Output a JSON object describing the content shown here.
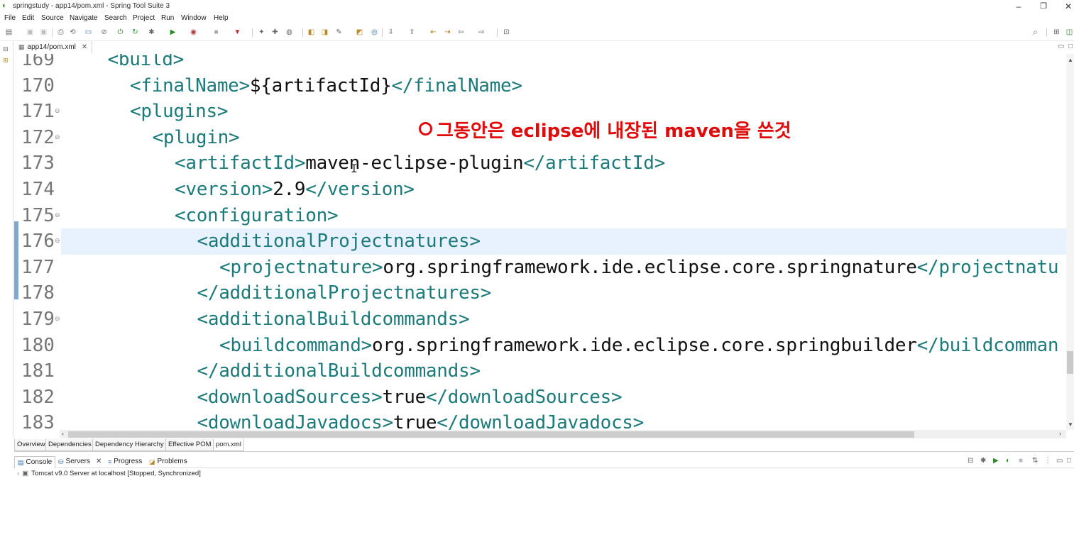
{
  "window": {
    "title": "springstudy - app14/pom.xml - Spring Tool Suite 3",
    "minimize": "–",
    "restore": "❐",
    "close": "✕"
  },
  "menu": [
    "File",
    "Edit",
    "Source",
    "Navigate",
    "Search",
    "Project",
    "Run",
    "Window",
    "Help"
  ],
  "editor_tab": {
    "label": "app14/pom.xml",
    "close": "✕"
  },
  "editor_lines": [
    {
      "num": "169",
      "indent": 1,
      "parts": [
        {
          "t": "tag",
          "s": "<build>"
        }
      ],
      "fold": false,
      "active": false
    },
    {
      "num": "170",
      "indent": 2,
      "parts": [
        {
          "t": "tag",
          "s": "<finalName>"
        },
        {
          "t": "txt",
          "s": "${artifactId}"
        },
        {
          "t": "tag",
          "s": "</finalName>"
        }
      ],
      "fold": false,
      "active": false
    },
    {
      "num": "171",
      "indent": 2,
      "parts": [
        {
          "t": "tag",
          "s": "<plugins>"
        }
      ],
      "fold": true,
      "active": false
    },
    {
      "num": "172",
      "indent": 3,
      "parts": [
        {
          "t": "tag",
          "s": "<plugin>"
        }
      ],
      "fold": true,
      "active": false
    },
    {
      "num": "173",
      "indent": 4,
      "parts": [
        {
          "t": "tag",
          "s": "<artifactId>"
        },
        {
          "t": "txt",
          "s": "maven-eclipse-plugin"
        },
        {
          "t": "tag",
          "s": "</artifactId>"
        }
      ],
      "fold": false,
      "active": false
    },
    {
      "num": "174",
      "indent": 4,
      "parts": [
        {
          "t": "tag",
          "s": "<version>"
        },
        {
          "t": "txt",
          "s": "2.9"
        },
        {
          "t": "tag",
          "s": "</version>"
        }
      ],
      "fold": false,
      "active": false
    },
    {
      "num": "175",
      "indent": 4,
      "parts": [
        {
          "t": "tag",
          "s": "<configuration>"
        }
      ],
      "fold": true,
      "active": false
    },
    {
      "num": "176",
      "indent": 5,
      "parts": [
        {
          "t": "tag",
          "s": "<additionalProjectnatures>"
        }
      ],
      "fold": true,
      "active": true
    },
    {
      "num": "177",
      "indent": 6,
      "parts": [
        {
          "t": "tag",
          "s": "<projectnature>"
        },
        {
          "t": "txt",
          "s": "org.springframework.ide.eclipse.core.springnature"
        },
        {
          "t": "tag",
          "s": "</projectnatu"
        }
      ],
      "fold": false,
      "active": false
    },
    {
      "num": "178",
      "indent": 5,
      "parts": [
        {
          "t": "tag",
          "s": "</additionalProjectnatures>"
        }
      ],
      "fold": false,
      "active": false
    },
    {
      "num": "179",
      "indent": 5,
      "parts": [
        {
          "t": "tag",
          "s": "<additionalBuildcommands>"
        }
      ],
      "fold": true,
      "active": false
    },
    {
      "num": "180",
      "indent": 6,
      "parts": [
        {
          "t": "tag",
          "s": "<buildcommand>"
        },
        {
          "t": "txt",
          "s": "org.springframework.ide.eclipse.core.springbuilder"
        },
        {
          "t": "tag",
          "s": "</buildcomman"
        }
      ],
      "fold": false,
      "active": false
    },
    {
      "num": "181",
      "indent": 5,
      "parts": [
        {
          "t": "tag",
          "s": "</additionalBuildcommands>"
        }
      ],
      "fold": false,
      "active": false
    },
    {
      "num": "182",
      "indent": 5,
      "parts": [
        {
          "t": "tag",
          "s": "<downloadSources>"
        },
        {
          "t": "txt",
          "s": "true"
        },
        {
          "t": "tag",
          "s": "</downloadSources>"
        }
      ],
      "fold": false,
      "active": false
    },
    {
      "num": "183",
      "indent": 5,
      "parts": [
        {
          "t": "tag",
          "s": "<downloadJavadocs>"
        },
        {
          "t": "txt",
          "s": "true"
        },
        {
          "t": "tag",
          "s": "</downloadJavadocs>"
        }
      ],
      "fold": false,
      "active": false
    }
  ],
  "annotation": "그동안은 eclipse에 내장된 maven을 쓴것",
  "pom_tabs": [
    "Overview",
    "Dependencies",
    "Dependency Hierarchy",
    "Effective POM",
    "pom.xml"
  ],
  "console_tabs": [
    {
      "label": "Console",
      "icon": "console-icon"
    },
    {
      "label": "Servers",
      "icon": "servers-icon",
      "close": "✕"
    },
    {
      "label": "Progress",
      "icon": "progress-icon"
    },
    {
      "label": "Problems",
      "icon": "problems-icon"
    }
  ],
  "server_row": "Tomcat v9.0 Server at localhost  [Stopped, Synchronized]",
  "colors": {
    "tag": "#1d7a7a",
    "annotation": "#e00b0b",
    "active_line": "#e8f2fe"
  }
}
